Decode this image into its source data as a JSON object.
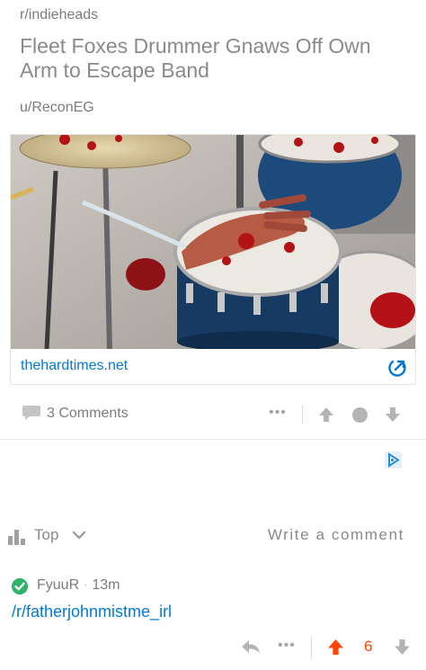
{
  "post": {
    "subreddit": "r/indieheads",
    "title": "Fleet Foxes Drummer Gnaws Off Own Arm to Escape Band",
    "author": "u/ReconEG",
    "link_domain": "thehardtimes.net",
    "comment_count": "3 Comments",
    "more_label": "•••"
  },
  "sort": {
    "label": "Top",
    "write_comment": "Write a comment"
  },
  "comment": {
    "username": "FyuuR",
    "separator": "·",
    "age": "13m",
    "body": "/r/fatherjohnmistme_irl",
    "more_label": "•••",
    "score": "6"
  },
  "colors": {
    "link": "#0079d3",
    "upvote_active": "#ff4500",
    "verified": "#2fb26a",
    "meta": "#7c7c7c"
  },
  "icons": [
    "comment-bubble-icon",
    "external-link-icon",
    "upvote-arrow-icon",
    "award-circle-icon",
    "downvote-arrow-icon",
    "ad-choices-icon",
    "sort-bars-icon",
    "chevron-down-icon",
    "verified-check-icon",
    "reply-icon"
  ]
}
